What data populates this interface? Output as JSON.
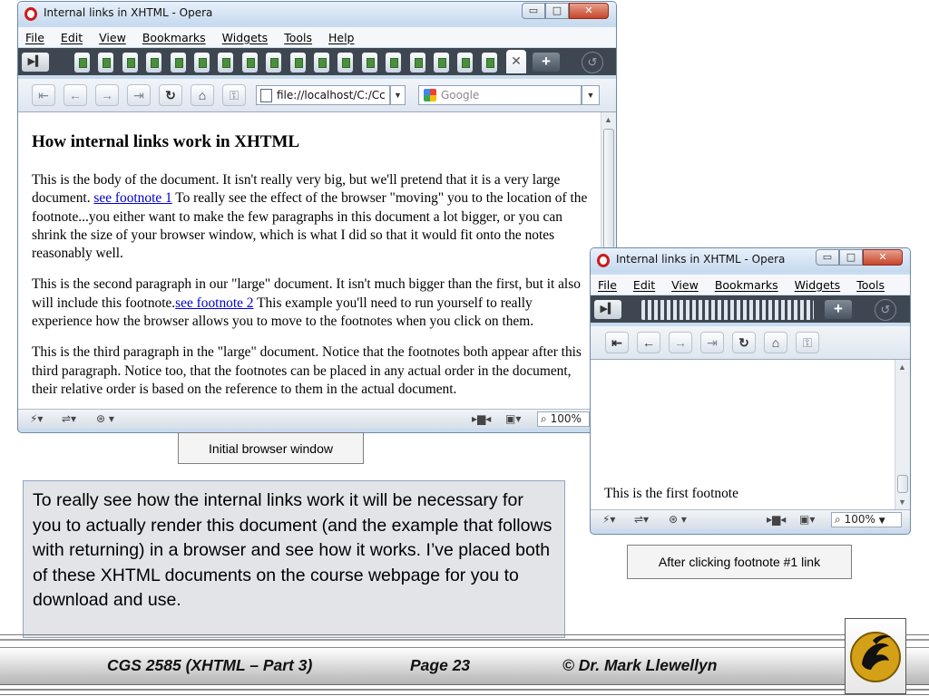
{
  "window1": {
    "title": "Internal links in XHTML - Opera",
    "menu": [
      "File",
      "Edit",
      "View",
      "Bookmarks",
      "Widgets",
      "Tools",
      "Help"
    ],
    "controls": {
      "minimize": "▭",
      "maximize": "□",
      "close": "✕"
    },
    "address": "file://localhost/C:/Cc",
    "search_placeholder": "Google",
    "heading": "How internal links work in XHTML",
    "paragraphs": [
      {
        "before": "This is the body of the document. It isn't really very big, but we'll pretend that it is a very large document. ",
        "link": "see footnote 1",
        "after": " To really see the effect of the browser \"moving\" you to the location of the footnote...you either want to make the few paragraphs in this document a lot bigger, or you can shrink the size of your browser window, which is what I did so that it would fit onto the notes reasonably well."
      },
      {
        "before": "This is the second paragraph in our \"large\" document. It isn't much bigger than the first, but it also will include this footnote.",
        "link": "see footnote 2",
        "after": " This example you'll need to run yourself to really experience how the browser allows you to move to the footnotes when you click on them."
      },
      {
        "before": "This is the third paragraph in the \"large\" document. Notice that the footnotes both appear after this third paragraph. Notice too, that the footnotes can be placed in any actual order in the document, their relative order is based on the reference to them in the actual document.",
        "link": "",
        "after": ""
      }
    ],
    "zoom": "100%"
  },
  "window2": {
    "title": "Internal links in XHTML - Opera",
    "menu": [
      "File",
      "Edit",
      "View",
      "Bookmarks",
      "Widgets",
      "Tools"
    ],
    "controls": {
      "minimize": "▭",
      "maximize": "□",
      "close": "✕"
    },
    "footnote_text": "This is the first footnote",
    "zoom": "100%"
  },
  "captions": {
    "initial": "Initial browser window",
    "after": "After clicking footnote #1 link"
  },
  "note": "To really see how the internal links work it will be necessary for you to actually render this document (and the example that follows with returning) in a browser and see how it works.  I’ve placed both of these XHTML documents on the course webpage for you to download and use.",
  "footer": {
    "course": "CGS 2585 (XHTML – Part 3)",
    "page": "Page 23",
    "author": "© Dr. Mark Llewellyn"
  },
  "colors": {
    "link": "#0000cc",
    "accent": "#d4a017",
    "opera_red": "#cc1b1b"
  },
  "icons": [
    "opera-icon",
    "back-icon",
    "forward-icon",
    "reload-icon",
    "home-icon",
    "wand-icon",
    "google-icon",
    "zoom-icon",
    "panel-icon",
    "new-tab-icon",
    "trash-icon"
  ]
}
